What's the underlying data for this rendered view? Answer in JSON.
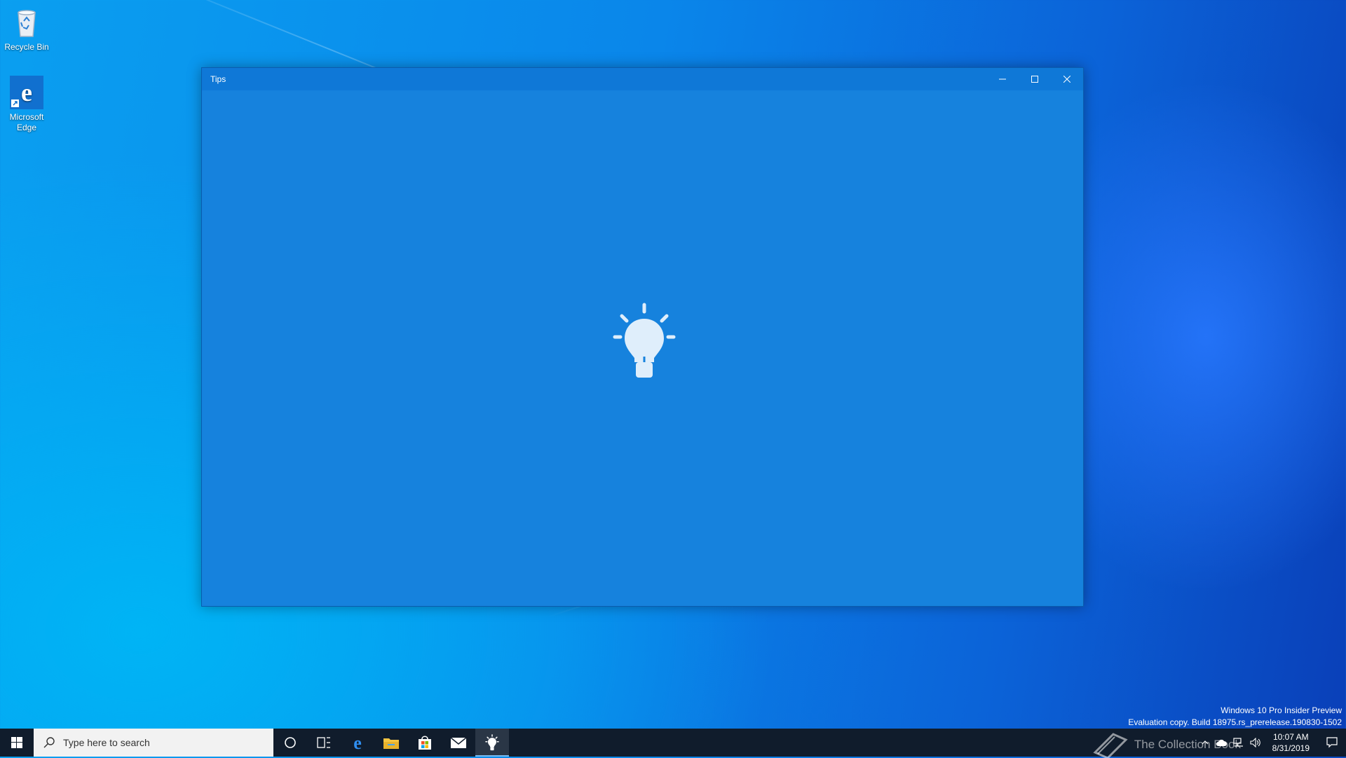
{
  "desktop": {
    "icons": [
      {
        "label": "Recycle Bin"
      },
      {
        "label": "Microsoft Edge"
      }
    ]
  },
  "window": {
    "title": "Tips",
    "splash_icon": "lightbulb-icon",
    "background_color": "#1682dd"
  },
  "watermark": {
    "line1": "Windows 10 Pro Insider Preview",
    "line2": "Evaluation copy. Build 18975.rs_prerelease.190830-1502"
  },
  "taskbar": {
    "search_placeholder": "Type here to search",
    "pinned": [
      "cortana-icon",
      "task-view-icon",
      "edge-icon",
      "file-explorer-icon",
      "store-icon",
      "mail-icon",
      "tips-icon"
    ],
    "active_app": "tips-icon"
  },
  "tray": {
    "overlay_text": "The Collection Book",
    "time": "10:07 AM",
    "date": "8/31/2019"
  }
}
